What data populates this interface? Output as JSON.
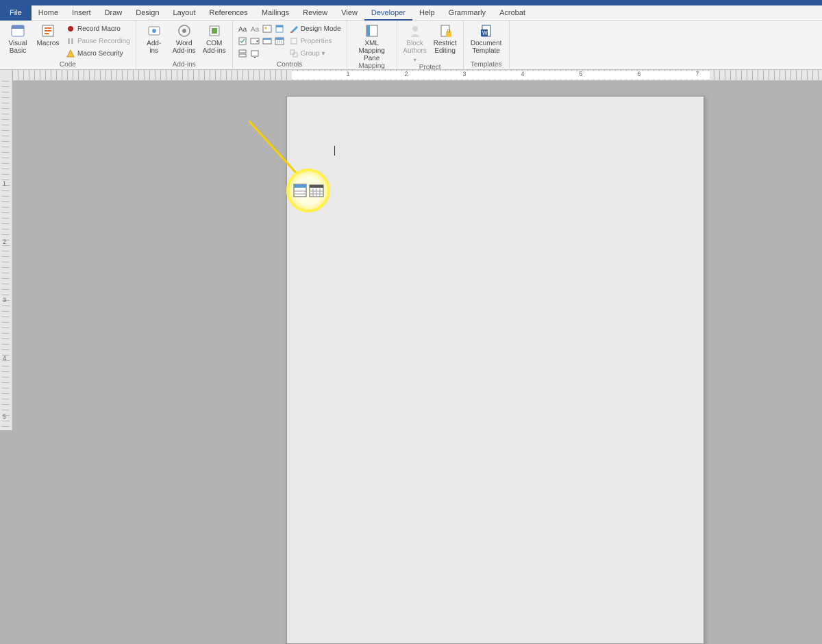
{
  "tabs": {
    "file": "File",
    "list": [
      "Home",
      "Insert",
      "Draw",
      "Design",
      "Layout",
      "References",
      "Mailings",
      "Review",
      "View",
      "Developer",
      "Help",
      "Grammarly",
      "Acrobat"
    ],
    "active": "Developer"
  },
  "ribbon": {
    "code": {
      "label": "Code",
      "visual_basic": "Visual\nBasic",
      "macros": "Macros",
      "record_macro": "Record Macro",
      "pause_recording": "Pause Recording",
      "macro_security": "Macro Security"
    },
    "addins": {
      "label": "Add-ins",
      "addins": "Add-\nins",
      "word_addins": "Word\nAdd-ins",
      "com_addins": "COM\nAdd-ins"
    },
    "controls": {
      "label": "Controls",
      "design_mode": "Design Mode",
      "properties": "Properties",
      "group": "Group"
    },
    "mapping": {
      "label": "Mapping",
      "xml_pane": "XML Mapping\nPane"
    },
    "protect": {
      "label": "Protect",
      "block_authors": "Block\nAuthors",
      "restrict_editing": "Restrict\nEditing"
    },
    "templates": {
      "label": "Templates",
      "doc_template": "Document\nTemplate"
    }
  },
  "ruler": {
    "nums": [
      "1",
      "2",
      "3",
      "4",
      "5",
      "6",
      "7"
    ]
  },
  "vruler": {
    "nums": [
      "1",
      "2",
      "3",
      "4",
      "5"
    ]
  }
}
